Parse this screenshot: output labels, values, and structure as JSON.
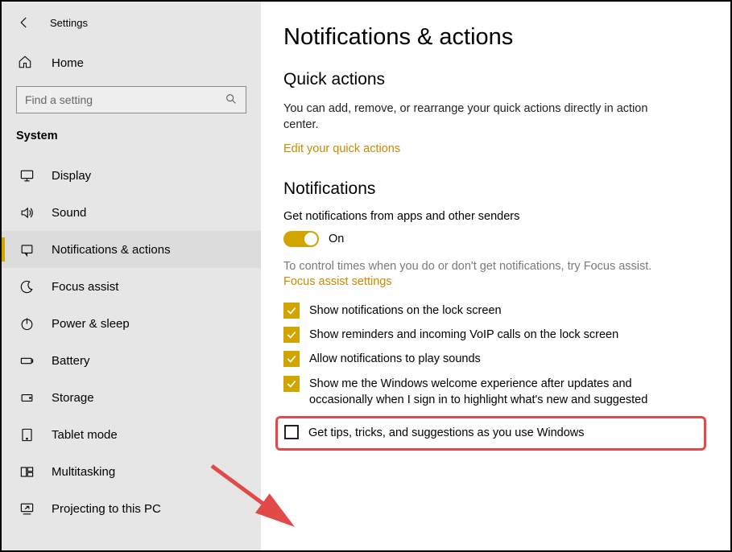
{
  "app": {
    "title": "Settings",
    "home_label": "Home"
  },
  "search": {
    "placeholder": "Find a setting"
  },
  "category": "System",
  "sidebar": {
    "items": [
      {
        "label": "Display",
        "icon": "monitor"
      },
      {
        "label": "Sound",
        "icon": "speaker"
      },
      {
        "label": "Notifications & actions",
        "icon": "notification",
        "selected": true
      },
      {
        "label": "Focus assist",
        "icon": "moon"
      },
      {
        "label": "Power & sleep",
        "icon": "power"
      },
      {
        "label": "Battery",
        "icon": "battery"
      },
      {
        "label": "Storage",
        "icon": "storage"
      },
      {
        "label": "Tablet mode",
        "icon": "tablet"
      },
      {
        "label": "Multitasking",
        "icon": "multitask"
      },
      {
        "label": "Projecting to this PC",
        "icon": "project"
      }
    ]
  },
  "main": {
    "title": "Notifications & actions",
    "quick_actions": {
      "heading": "Quick actions",
      "description": "You can add, remove, or rearrange your quick actions directly in action center.",
      "link": "Edit your quick actions"
    },
    "notifications": {
      "heading": "Notifications",
      "toggle_label": "Get notifications from apps and other senders",
      "toggle_state": "On",
      "focus_text": "To control times when you do or don't get notifications, try Focus assist.",
      "focus_link": "Focus assist settings",
      "checks": [
        {
          "label": "Show notifications on the lock screen",
          "checked": true
        },
        {
          "label": "Show reminders and incoming VoIP calls on the lock screen",
          "checked": true
        },
        {
          "label": "Allow notifications to play sounds",
          "checked": true
        },
        {
          "label": "Show me the Windows welcome experience after updates and occasionally when I sign in to highlight what's new and suggested",
          "checked": true
        },
        {
          "label": "Get tips, tricks, and suggestions as you use Windows",
          "checked": false,
          "highlight": true
        }
      ]
    }
  },
  "colors": {
    "accent": "#d2a400",
    "link": "#c98a00",
    "highlight_border": "#e24a4a"
  }
}
